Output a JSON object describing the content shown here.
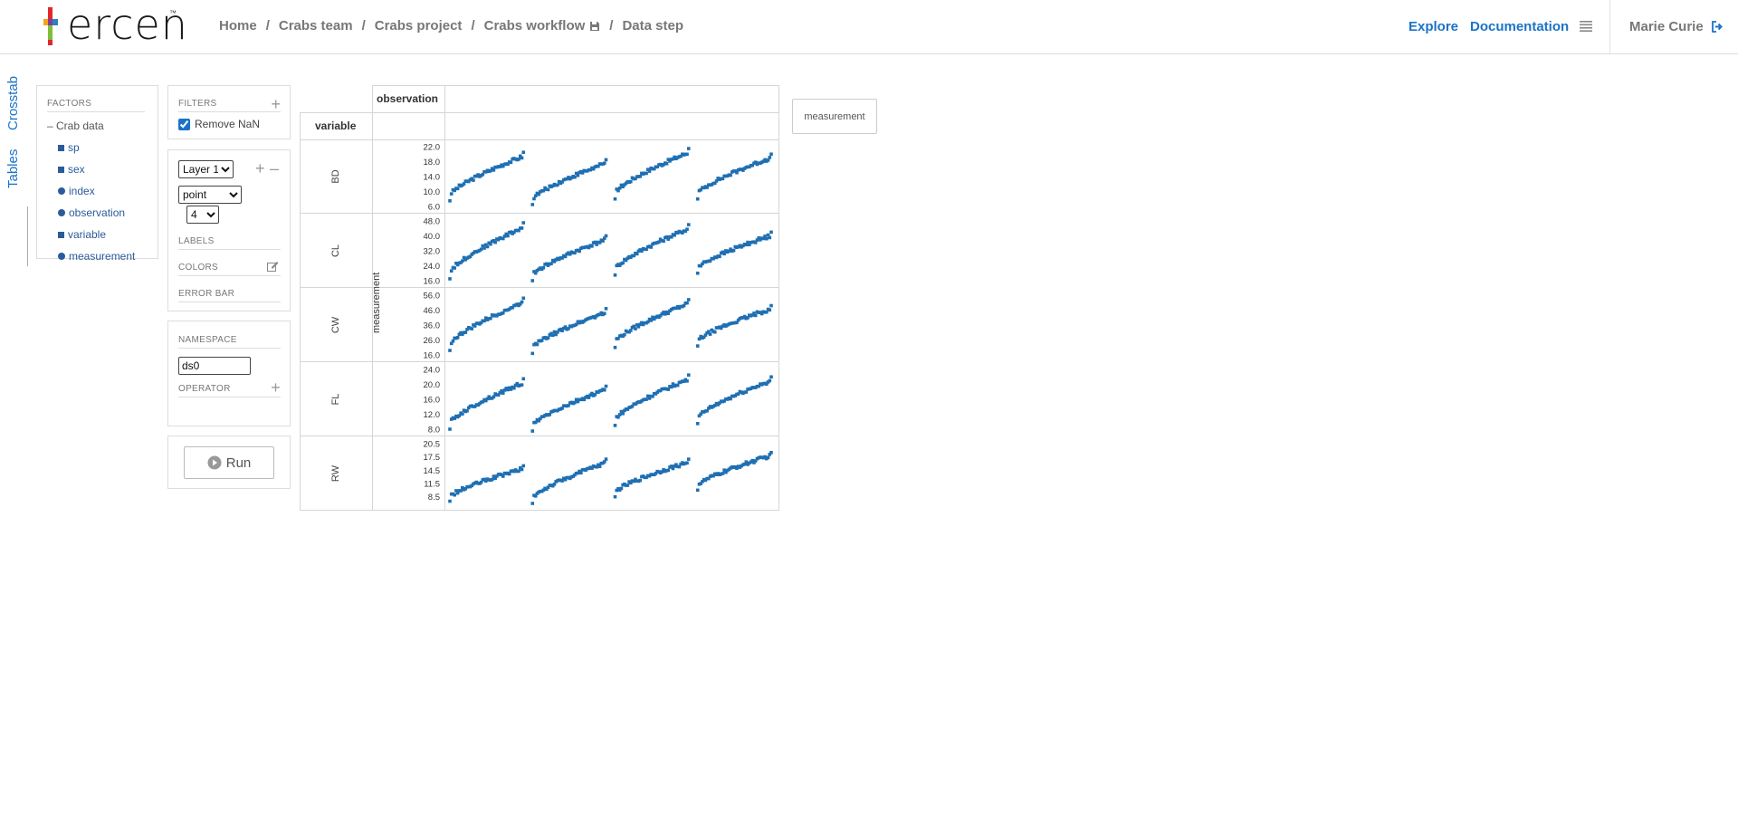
{
  "brand": {
    "logo_text": "ercen",
    "tm": "™",
    "colors": [
      "#e3262c",
      "#f7a11a",
      "#2f7fc1",
      "#7dbf3b",
      "#7b3f98"
    ]
  },
  "breadcrumb": {
    "items": [
      "Home",
      "Crabs team",
      "Crabs project",
      "Crabs workflow",
      "Data step"
    ],
    "separator": "/"
  },
  "nav": {
    "explore": "Explore",
    "documentation": "Documentation",
    "menu_icon": "hamburger-icon"
  },
  "user": {
    "name": "Marie Curie",
    "icon": "sign-out-icon"
  },
  "side_tabs": {
    "crosstab": "Crosstab",
    "tables": "Tables"
  },
  "factors": {
    "title": "FACTORS",
    "root": "Crab data",
    "items": [
      {
        "label": "sp",
        "kind": "square"
      },
      {
        "label": "sex",
        "kind": "square"
      },
      {
        "label": "index",
        "kind": "circle"
      },
      {
        "label": "observation",
        "kind": "circle"
      },
      {
        "label": "variable",
        "kind": "square"
      },
      {
        "label": "measurement",
        "kind": "circle"
      }
    ]
  },
  "filters": {
    "title": "FILTERS",
    "remove_nan": "Remove NaN",
    "remove_nan_checked": true
  },
  "layer": {
    "layer_select": "Layer 1",
    "chart_type": "point",
    "point_size": "4",
    "labels_title": "LABELS",
    "colors_title": "COLORS",
    "error_bar_title": "ERROR BAR"
  },
  "namespace": {
    "title": "NAMESPACE",
    "value": "ds0",
    "operator_title": "OPERATOR"
  },
  "run": {
    "label": "Run"
  },
  "crosstab": {
    "col_header": "observation",
    "row_header": "variable",
    "y_axis_label": "measurement",
    "y_chip": "measurement",
    "accent": "#1f6fb2"
  },
  "chart_data": {
    "type": "scatter",
    "x_factor": "observation",
    "y_factor": "measurement",
    "row_factor": "variable",
    "panels_per_row": 4,
    "rows": [
      {
        "name": "BD",
        "ticks": [
          "22.0",
          "18.0",
          "14.0",
          "10.0",
          "6.0"
        ],
        "ylim": [
          6.0,
          22.0
        ],
        "segments": [
          [
            7.5,
            20.5
          ],
          [
            6.5,
            18.5
          ],
          [
            8.0,
            21.5
          ],
          [
            8.0,
            20.0
          ]
        ]
      },
      {
        "name": "CL",
        "ticks": [
          "48.0",
          "40.0",
          "32.0",
          "24.0",
          "16.0"
        ],
        "ylim": [
          16.0,
          48.0
        ],
        "segments": [
          [
            17.0,
            47.0
          ],
          [
            16.0,
            40.0
          ],
          [
            19.0,
            46.0
          ],
          [
            20.0,
            42.0
          ]
        ]
      },
      {
        "name": "CW",
        "ticks": [
          "56.0",
          "46.0",
          "36.0",
          "26.0",
          "16.0"
        ],
        "ylim": [
          16.0,
          56.0
        ],
        "segments": [
          [
            19.0,
            54.0
          ],
          [
            17.0,
            47.0
          ],
          [
            21.0,
            53.0
          ],
          [
            22.0,
            49.0
          ]
        ]
      },
      {
        "name": "FL",
        "ticks": [
          "24.0",
          "20.0",
          "16.0",
          "12.0",
          "8.0"
        ],
        "ylim": [
          8.0,
          24.0
        ],
        "segments": [
          [
            8.0,
            21.5
          ],
          [
            7.5,
            19.5
          ],
          [
            9.0,
            22.5
          ],
          [
            9.5,
            22.0
          ]
        ]
      },
      {
        "name": "RW",
        "ticks": [
          "20.5",
          "17.5",
          "14.5",
          "11.5",
          "8.5"
        ],
        "ylim": [
          7.0,
          20.5
        ],
        "segments": [
          [
            7.5,
            15.5
          ],
          [
            7.0,
            17.0
          ],
          [
            8.5,
            17.0
          ],
          [
            10.0,
            18.5
          ]
        ]
      }
    ]
  }
}
